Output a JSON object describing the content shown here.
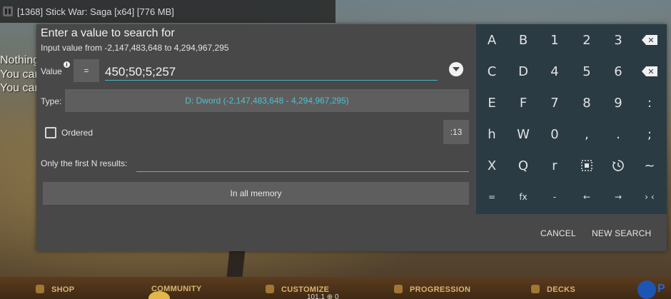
{
  "topbar": {
    "title": "[1368] Stick War: Saga [x64] [776 MB]"
  },
  "game": {
    "left_lines": [
      "Nothing",
      "You car",
      "You car"
    ],
    "tabs": [
      "SHOP",
      "COMMUNITY",
      "CUSTOMIZE",
      "PROGRESSION",
      "DECKS"
    ],
    "counter": "101.1 ⊕ 0",
    "round_label": "P"
  },
  "dialog": {
    "title": "Enter a value to search for",
    "range": "Input value from -2,147,483,648 to 4,294,967,295",
    "value_label": "Value",
    "eq_label": "=",
    "value": "450;50;5;257",
    "type_label": "Type:",
    "type_value": "D: Dword (-2,147,483,648 - 4,294,967,295)",
    "ordered_label": "Ordered",
    "ordered_checked": false,
    "ordered_range": ":13",
    "first_n_label": "Only the first N results:",
    "first_n_value": "",
    "memory_button": "In all memory",
    "cancel": "CANCEL",
    "new_search": "NEW SEARCH"
  },
  "keypad": {
    "rows": [
      [
        "A",
        "B",
        "1",
        "2",
        "3",
        "⌫"
      ],
      [
        "C",
        "D",
        "4",
        "5",
        "6",
        "⌫"
      ],
      [
        "E",
        "F",
        "7",
        "8",
        "9",
        ":"
      ],
      [
        "h",
        "W",
        "0",
        ",",
        ".",
        ";"
      ],
      [
        "X",
        "Q",
        "r",
        "⊡",
        "⟲",
        "~"
      ],
      [
        "=",
        "fx",
        "-",
        "←",
        "→",
        "› ‹"
      ]
    ]
  }
}
